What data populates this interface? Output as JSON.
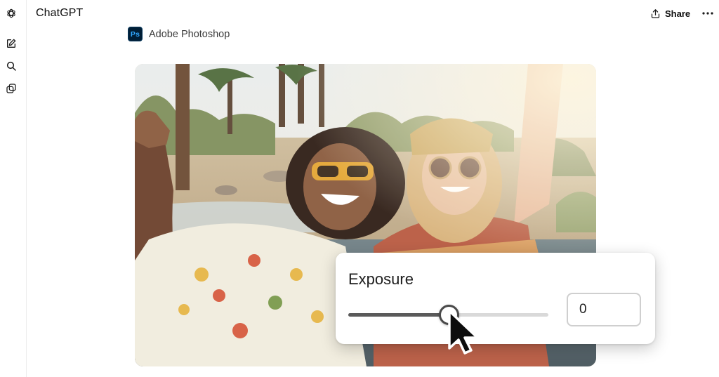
{
  "app": {
    "title": "ChatGPT"
  },
  "header": {
    "share_label": "Share"
  },
  "tool": {
    "name": "Adobe Photoshop",
    "logo_text": "Ps"
  },
  "panel": {
    "title": "Exposure",
    "slider_fraction": 0.5,
    "value": "0"
  },
  "icons": {
    "rail": [
      "openai-logo-icon",
      "new-chat-icon",
      "search-icon",
      "library-icon"
    ],
    "header": [
      "share-icon",
      "more-options-icon"
    ]
  },
  "colors": {
    "ps_logo_bg": "#001e36",
    "ps_logo_text": "#31a8ff",
    "slider_fill": "#5a5a5a",
    "slider_track": "#d9d9d9"
  }
}
